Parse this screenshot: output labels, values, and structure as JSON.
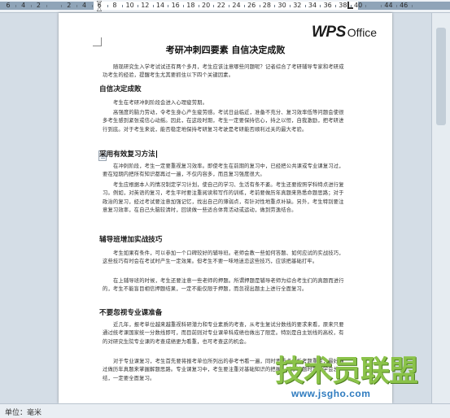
{
  "ruler": {
    "numbers": [
      "6",
      "4",
      "2",
      "",
      "2",
      "4",
      "6",
      "8",
      "10",
      "12",
      "14",
      "16",
      "18",
      "20",
      "22",
      "24",
      "26",
      "28",
      "30",
      "32",
      "34",
      "36",
      "38",
      "40",
      "",
      "44",
      "46"
    ]
  },
  "document": {
    "logo_main": "WPS",
    "logo_sub": "Office",
    "title": "考研冲刺四要素 自信决定成败",
    "intro": "随现研究生入学考试试还有两个多月，考生应该注意哪些问题呢？记者综合了考研辅导专家和考研成功考生的经验，提醒考生尤其要抓住以下四个关键因素。",
    "sections": [
      {
        "heading": "自信决定成败",
        "paragraphs": [
          "考生在考研冲刺阶段会进入心理疲劳期。",
          "高强度的脑力劳动，令考生身心产生疲劳感。考试日益临近，准备不充分、复习效率低等问题会使很多考生感到紧张或信心动摇。因此，在这段时期，考生一定要保持信心，持之以恒，自我激励，把考研进行到底。对于考生来说，能否稳定地保持考研复习考驶是考研能否顺利过关的最大考验。"
        ]
      },
      {
        "heading": "采用有效复习方法",
        "paragraphs": [
          "在冲刺阶段，考生一定要重视复习效率。即使考生在前期的复习中，已经把公共课或专业课复习过，要在短期内把所有知识都再过一遍，不仅内容多，而且复习强度很大。",
          "考生应根据本人的情况制定学习计划，使自己的学习、生活有条不紊。考生还要按照学科特点进行复习。例如，对英语的复习，考生平时要注重阅读和写作的训练，考前要做历年真题来熟悉命题思路；对于政治的复习，经过考试要注意加强记忆，找出自己的薄弱点，有针对性地重点补缺。另外，考生特别要注意复习效率，在自己头脑较清时，回读做一些适合体育活动或运动，做到劳逸结合。"
        ]
      },
      {
        "heading": "辅导班增加实战技巧",
        "paragraphs": [
          "考生如果有条件，可以参加一个口碑较好的辅导班。老师会教一些如何答题、如何应试的实战技巧，这些技巧有时会在考试时产生一定效果。但考生不要一味地迷恋这些技巧，应该把基础打牢。",
          "在上辅导班的时候，考生还要注意一些老师的押题。所谓押题是辅导老师为综合考生们的真题而进行的，考生不能盲目相信押题结果，一定不能仅限于押题，而忽视出题主上进行全面复习。"
        ]
      },
      {
        "heading": "不要忽视专业课准备",
        "paragraphs": [
          "近几年，报考单位越来越重视科研潜力和专业素质的考查，从考生复试分数线的要求来看，原来只要通过统考课国家统一分数线即可，而目前则对专业课单科成绩也做出了限定。特别是自主划线的高校，有的对研究生院专业课的考查成绩更为看重，也可考查这的机会。",
          "对于专业课复习，考生首先要将报考单位所列出的参考书看一遍，同时要重点分析考题重点，最好通过做历年真题来掌握解题思路。专业课复习中，考生要注重对基础知识的把握，对于答题时需要学会总结，一定要全面复习。"
        ]
      }
    ]
  },
  "watermark": {
    "main": "技术员联盟",
    "url": "www.jsgho.com"
  },
  "status_bar": {
    "unit_label": "单位：毫米"
  }
}
